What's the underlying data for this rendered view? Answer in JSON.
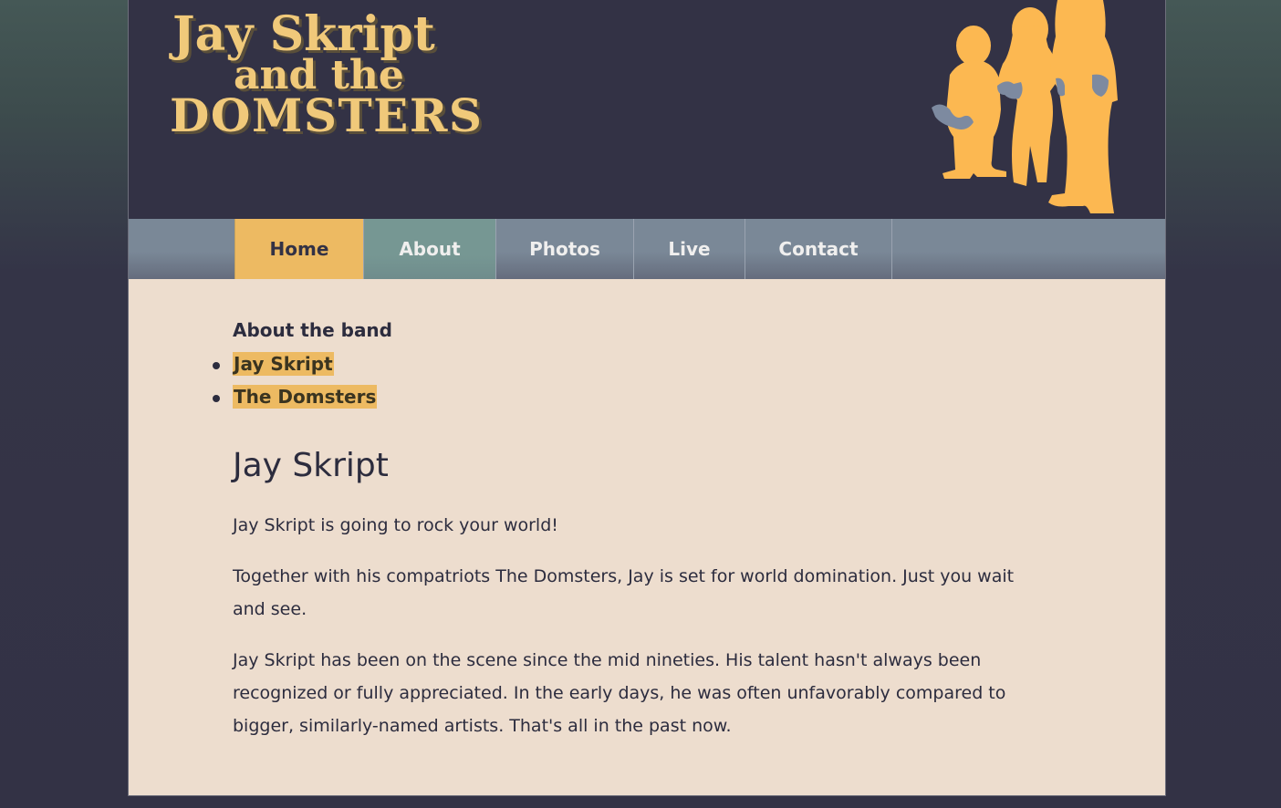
{
  "header": {
    "logo_text": {
      "line1": "Jay Skript",
      "line2": "and the",
      "line3": "DOMSTERS"
    }
  },
  "nav": {
    "items": [
      {
        "label": "Home"
      },
      {
        "label": "About"
      },
      {
        "label": "Photos"
      },
      {
        "label": "Live"
      },
      {
        "label": "Contact"
      }
    ]
  },
  "content": {
    "subnav_title": "About the band",
    "subnav_items": [
      {
        "label": "Jay Skript"
      },
      {
        "label": "The Domsters"
      }
    ],
    "heading": "Jay Skript",
    "paragraphs": [
      "Jay Skript is going to rock your world!",
      "Together with his compatriots The Domsters, Jay is set for world domination. Just you wait and see.",
      "Jay Skript has been on the scene since the mid nineties. His talent hasn't always been recognized or fully appreciated. In the early days, he was often unfavorably compared to bigger, similarly-named artists. That's all in the past now."
    ]
  },
  "colors": {
    "header_bg": "#333245",
    "accent": "#edba62",
    "content_bg": "#edddce",
    "nav_bg": "#7a8897",
    "about_tab_bg": "#769793",
    "logo_fill": "#f0c97a",
    "silhouette_fill": "#fcb851"
  }
}
